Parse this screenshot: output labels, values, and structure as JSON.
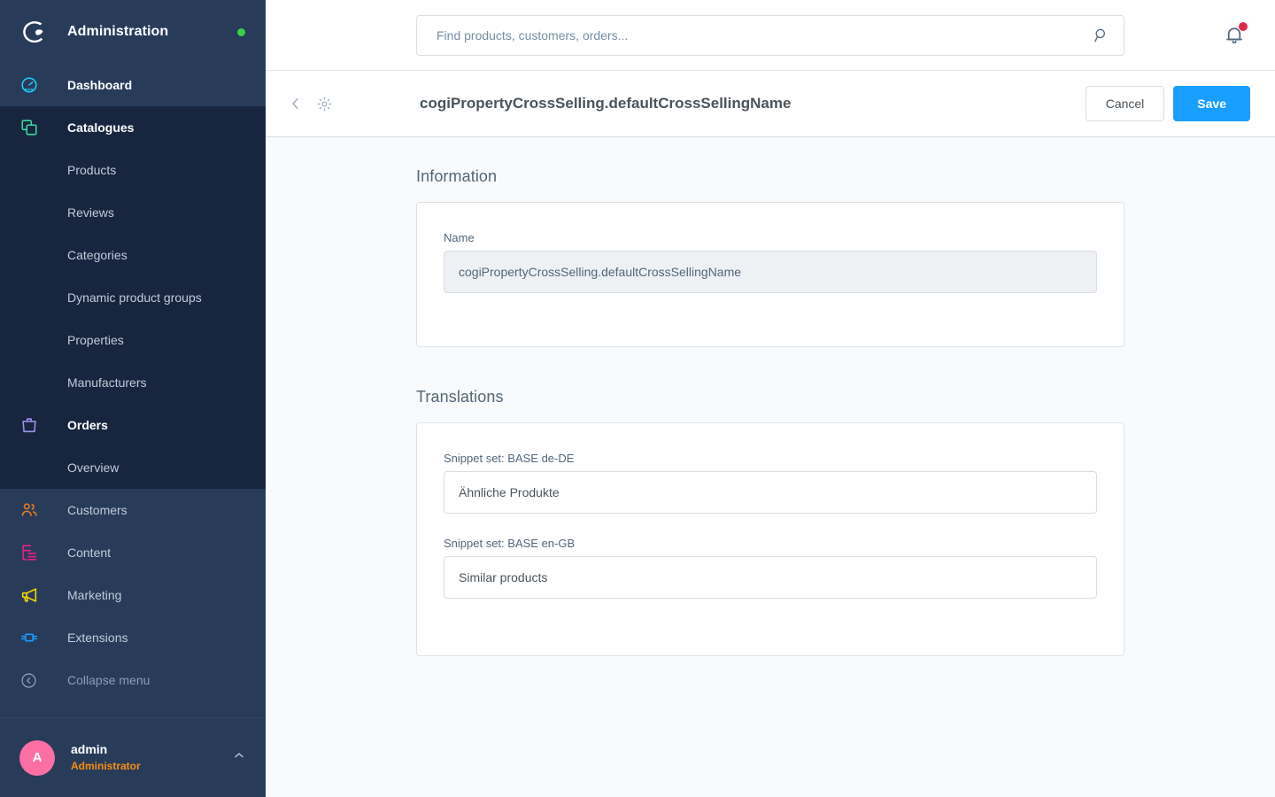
{
  "sidebar": {
    "brand": "Administration",
    "logo_icon": "shopware-logo-icon",
    "status_dot_color": "#37d046",
    "nav": [
      {
        "label": "Dashboard",
        "icon": "dashboard-gauge-icon",
        "icon_color": "#1ad4ff",
        "type": "parent",
        "expanded": false
      },
      {
        "label": "Catalogues",
        "icon": "catalogues-copy-icon",
        "icon_color": "#3dd9a0",
        "type": "parent",
        "expanded": true,
        "children": [
          {
            "label": "Products"
          },
          {
            "label": "Reviews"
          },
          {
            "label": "Categories"
          },
          {
            "label": "Dynamic product groups"
          },
          {
            "label": "Properties"
          },
          {
            "label": "Manufacturers"
          }
        ]
      },
      {
        "label": "Orders",
        "icon": "orders-bag-icon",
        "icon_color": "#a092f0",
        "type": "parent",
        "expanded": true,
        "children": [
          {
            "label": "Overview"
          }
        ]
      },
      {
        "label": "Customers",
        "icon": "customers-people-icon",
        "icon_color": "#ef7b22",
        "type": "item"
      },
      {
        "label": "Content",
        "icon": "content-document-icon",
        "icon_color": "#ed1e85",
        "type": "item"
      },
      {
        "label": "Marketing",
        "icon": "marketing-megaphone-icon",
        "icon_color": "#f8d900",
        "type": "item"
      },
      {
        "label": "Extensions",
        "icon": "extensions-plug-icon",
        "icon_color": "#189eff",
        "type": "item"
      },
      {
        "label": "Collapse menu",
        "icon": "collapse-chevron-left-icon",
        "icon_color": "#8a9dbb",
        "type": "collapse"
      }
    ],
    "user": {
      "avatar_initial": "A",
      "avatar_color": "#fc6fa4",
      "name": "admin",
      "role": "Administrator",
      "role_color": "#f88e10",
      "caret_icon": "chevron-up-icon"
    }
  },
  "topbar": {
    "search": {
      "placeholder": "Find products, customers, orders...",
      "value": "",
      "icon": "search-icon"
    },
    "notifications": {
      "icon": "bell-icon",
      "badge": true,
      "badge_color": "#de294c"
    }
  },
  "smartbar": {
    "back_icon": "chevron-left-icon",
    "settings_icon": "gear-icon",
    "title": "cogiPropertyCrossSelling.defaultCrossSellingName",
    "cancel_label": "Cancel",
    "save_label": "Save",
    "save_color": "#189eff"
  },
  "main": {
    "information": {
      "section_title": "Information",
      "name_label": "Name",
      "name_value": "cogiPropertyCrossSelling.defaultCrossSellingName"
    },
    "translations": {
      "section_title": "Translations",
      "fields": [
        {
          "label": "Snippet set: BASE de-DE",
          "value": "Ähnliche Produkte"
        },
        {
          "label": "Snippet set: BASE en-GB",
          "value": "Similar products"
        }
      ]
    }
  }
}
